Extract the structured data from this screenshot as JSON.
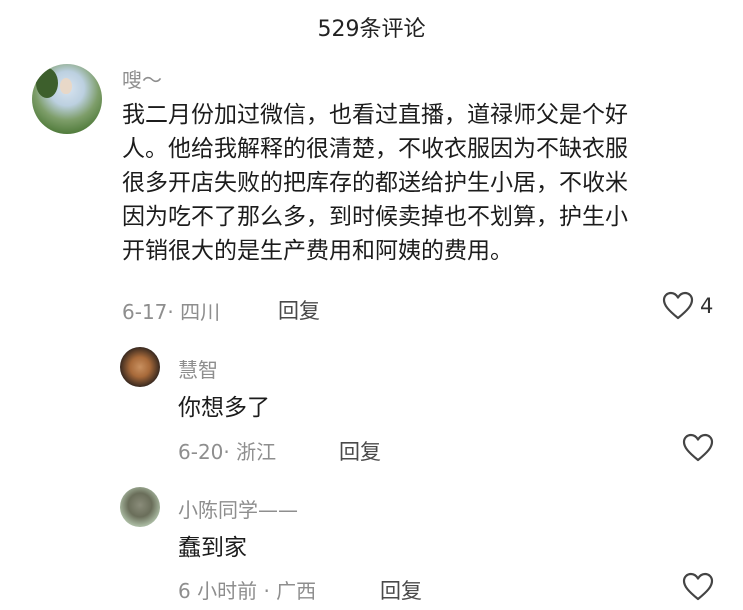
{
  "header": {
    "title": "529条评论"
  },
  "comments": [
    {
      "user": "嗖～",
      "lines": [
        "我二月份加过微信，也看过直播，道禄师父是个好",
        "人。他给我解释的很清楚，不收衣服因为不缺衣服",
        "很多开店失败的把库存的都送给护生小居，不收米",
        "因为吃不了那么多，到时候卖掉也不划算，护生小",
        "开销很大的是生产费用和阿姨的费用。"
      ],
      "meta": "6-17· 四川",
      "reply_label": "回复",
      "like_icon": "heart-outline-icon",
      "likes": "4"
    },
    {
      "user": "慧智",
      "text": "你想多了",
      "meta": "6-20· 浙江",
      "reply_label": "回复",
      "like_icon": "heart-outline-icon"
    },
    {
      "user": "小陈同学——",
      "text": "蠢到家",
      "meta": "6 小时前 · 广西",
      "reply_label": "回复",
      "like_icon": "heart-outline-icon"
    }
  ]
}
